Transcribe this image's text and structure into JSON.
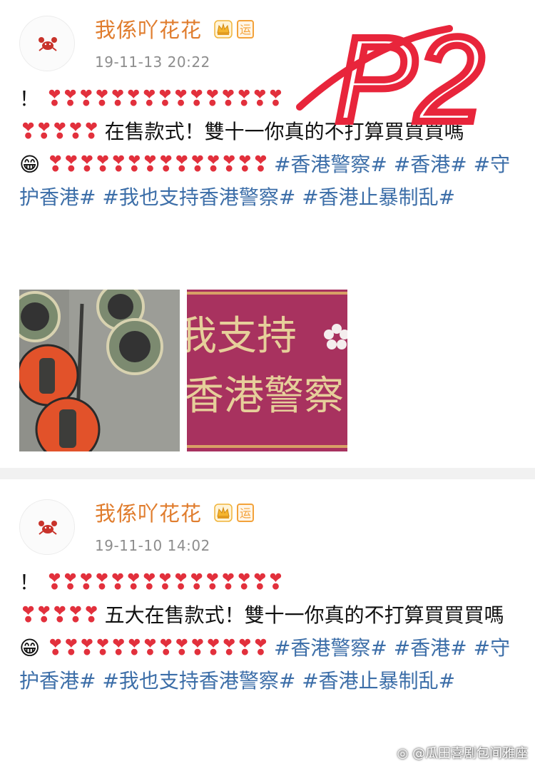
{
  "posts": [
    {
      "username": "我係吖花花",
      "badge_label": "运",
      "timestamp": "19-11-13 20:22",
      "line1_prefix": "！",
      "hearts_a": "❣❣❣❣❣❣❣❣❣❣❣❣❣❣❣",
      "hearts_b": "❣❣❣❣❣",
      "main_text": "在售款式！雙十一你真的不打算買買買嗎",
      "grin_emoji": "😁",
      "hearts_c": "❣❣❣❣❣❣❣❣❣❣❣❣❣❣",
      "tags": [
        "#香港警察#",
        "#香港#",
        "#守护香港#",
        "#我也支持香港警察#",
        "#香港止暴制乱#"
      ],
      "image2_text_line1": "我支持",
      "image2_text_line2": "香港警察",
      "annotation": "P2"
    },
    {
      "username": "我係吖花花",
      "badge_label": "运",
      "timestamp": "19-11-10 14:02",
      "line1_prefix": "！",
      "hearts_a": "❣❣❣❣❣❣❣❣❣❣❣❣❣❣❣",
      "hearts_b": "❣❣❣❣❣",
      "main_text": "五大在售款式！雙十一你真的不打算買買買嗎",
      "grin_emoji": "😁",
      "hearts_c": "❣❣❣❣❣❣❣❣❣❣❣❣❣❣",
      "tags": [
        "#香港警察#",
        "#香港#",
        "#守护香港#",
        "#我也支持香港警察#",
        "#香港止暴制乱#"
      ]
    }
  ],
  "watermark": "@瓜田喜剧包间雅座",
  "colors": {
    "username": "#e07d2e",
    "hashtag": "#3c6ea8",
    "heart": "#e2303c",
    "annotation": "#e8253b"
  },
  "icons": {
    "avatar": "crab-icon",
    "vip": "crown-icon",
    "heart": "heart-exclamation-icon",
    "grin": "grinning-face-icon",
    "watermark_logo": "weibo-icon"
  }
}
